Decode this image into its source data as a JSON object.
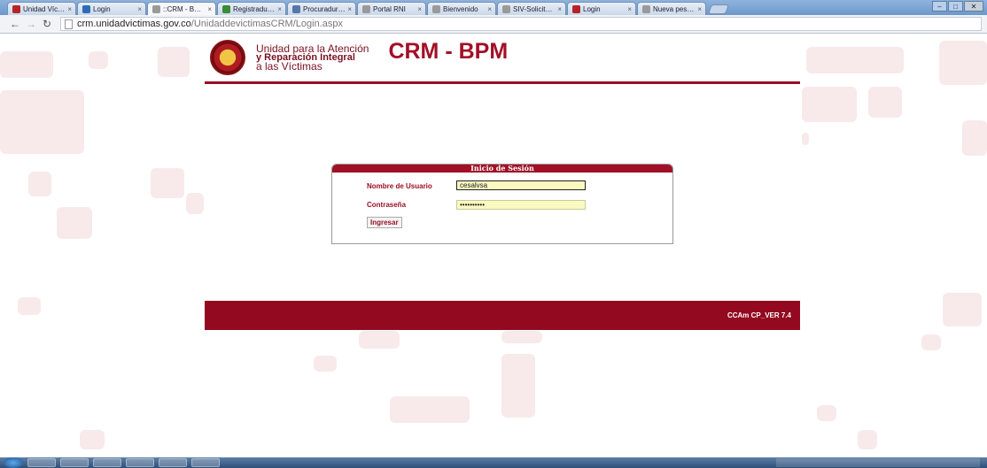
{
  "browser": {
    "tabs": [
      {
        "title": "Unidad Víctimas",
        "icon": "victimas-icon",
        "color": "#b4232a",
        "active": false
      },
      {
        "title": "Login",
        "icon": "login-icon",
        "color": "#2e6ab8",
        "active": false
      },
      {
        "title": "::CRM - BPM::",
        "icon": "page-icon",
        "color": "#9a9a9a",
        "active": true
      },
      {
        "title": "Registraduría Na...",
        "icon": "registraduria-icon",
        "color": "#3a8a3a",
        "active": false
      },
      {
        "title": "Procuraduría Ger...",
        "icon": "procuraduria-icon",
        "color": "#5577aa",
        "active": false
      },
      {
        "title": "Portal RNI",
        "icon": "page-icon",
        "color": "#9a9a9a",
        "active": false
      },
      {
        "title": "Bienvenido",
        "icon": "page-icon",
        "color": "#9a9a9a",
        "active": false
      },
      {
        "title": "SIV-Solicitudes",
        "icon": "page-icon",
        "color": "#9a9a9a",
        "active": false
      },
      {
        "title": "Login",
        "icon": "victimas-icon",
        "color": "#b4232a",
        "active": false
      },
      {
        "title": "Nueva pestaña",
        "icon": "page-icon",
        "color": "#9a9a9a",
        "active": false
      }
    ],
    "url_host": "crm.unidadvictimas.gov.co",
    "url_path": "/UnidaddevictimasCRM/Login.aspx"
  },
  "logo": {
    "line1": "Unidad para la Atención",
    "line2": "y Reparación Integral",
    "line3": "a las Víctimas"
  },
  "app_title": "CRM - BPM",
  "login": {
    "heading": "Inicio de Sesión",
    "username_label": "Nombre de Usuario",
    "username_value": "cesalvsa",
    "password_label": "Contraseña",
    "password_value": "••••••••••",
    "submit_label": "Ingresar"
  },
  "footer": {
    "version": "CCAm CP_VER 7.4"
  },
  "colors": {
    "brand": "#9e0d25",
    "footer": "#93091f",
    "input_bg": "#fafac0"
  }
}
